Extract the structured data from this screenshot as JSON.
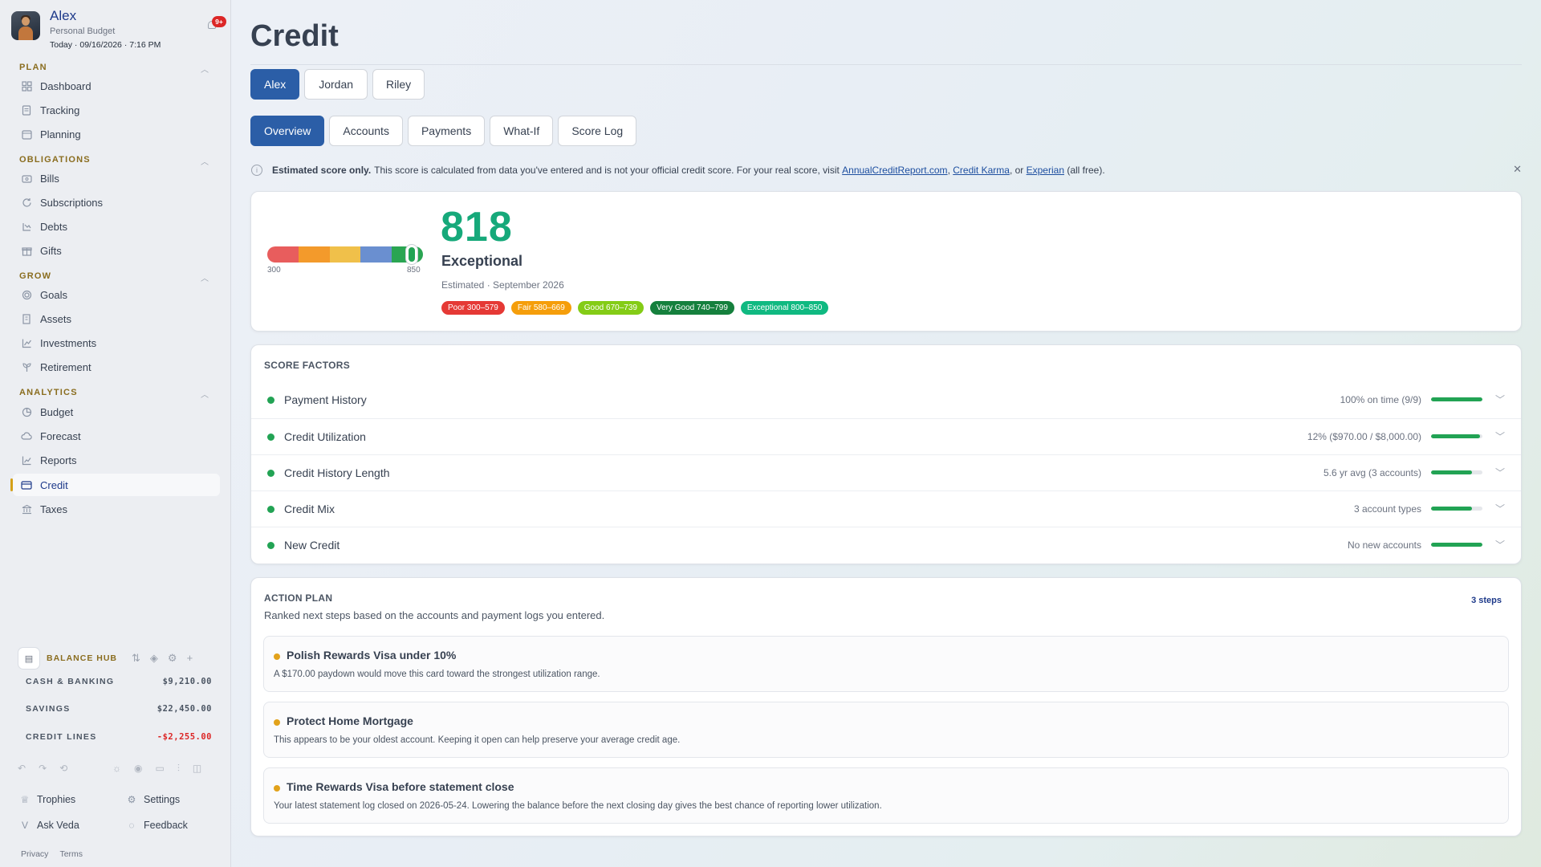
{
  "profile": {
    "name": "Alex",
    "subtitle": "Personal Budget",
    "date": "Today · 09/16/2026 · 7:16 PM",
    "notifications": "9+"
  },
  "sidebar": {
    "sections": [
      {
        "title": "PLAN",
        "items": [
          {
            "label": "Dashboard",
            "icon": "grid-icon"
          },
          {
            "label": "Tracking",
            "icon": "receipt-icon"
          },
          {
            "label": "Planning",
            "icon": "calendar-icon"
          }
        ]
      },
      {
        "title": "OBLIGATIONS",
        "items": [
          {
            "label": "Bills",
            "icon": "bill-icon"
          },
          {
            "label": "Subscriptions",
            "icon": "refresh-icon"
          },
          {
            "label": "Debts",
            "icon": "debt-icon"
          },
          {
            "label": "Gifts",
            "icon": "gift-icon"
          }
        ]
      },
      {
        "title": "GROW",
        "items": [
          {
            "label": "Goals",
            "icon": "target-icon"
          },
          {
            "label": "Assets",
            "icon": "building-icon"
          },
          {
            "label": "Investments",
            "icon": "trend-icon"
          },
          {
            "label": "Retirement",
            "icon": "sprout-icon"
          }
        ]
      },
      {
        "title": "ANALYTICS",
        "items": [
          {
            "label": "Budget",
            "icon": "pie-icon"
          },
          {
            "label": "Forecast",
            "icon": "cloud-icon"
          },
          {
            "label": "Reports",
            "icon": "chart-icon"
          },
          {
            "label": "Credit",
            "icon": "card-icon",
            "active": true
          },
          {
            "label": "Taxes",
            "icon": "bank-icon"
          }
        ]
      }
    ]
  },
  "balance_hub": {
    "title": "BALANCE HUB",
    "rows": [
      {
        "label": "CASH & BANKING",
        "value": "$9,210.00"
      },
      {
        "label": "SAVINGS",
        "value": "$22,450.00"
      },
      {
        "label": "CREDIT LINES",
        "value": "-$2,255.00",
        "negative": true
      }
    ]
  },
  "footer": {
    "trophies": "Trophies",
    "settings": "Settings",
    "ask": "Ask Veda",
    "feedback": "Feedback",
    "privacy": "Privacy",
    "terms": "Terms"
  },
  "main": {
    "title": "Credit",
    "people": [
      "Alex",
      "Jordan",
      "Riley"
    ],
    "tabs": [
      "Overview",
      "Accounts",
      "Payments",
      "What-If",
      "Score Log"
    ],
    "notice": {
      "bold": "Estimated score only.",
      "text": "This score is calculated from data you've entered and is not your official credit score. For your real score, visit",
      "link1": "AnnualCreditReport.com",
      "sep1": ",",
      "link2": "Credit Karma",
      "sep2": ", or",
      "link3": "Experian",
      "tail": "(all free)."
    },
    "score": {
      "value": "818",
      "rating": "Exceptional",
      "estimated": "Estimated · September 2026",
      "range_min": "300",
      "range_max": "850",
      "score_num": 818,
      "bands": [
        {
          "label": "Poor 300–579",
          "color": "#e53935"
        },
        {
          "label": "Fair 580–669",
          "color": "#f59e0b"
        },
        {
          "label": "Good 670–739",
          "color": "#84cc16"
        },
        {
          "label": "Very Good 740–799",
          "color": "#15803d"
        },
        {
          "label": "Exceptional 800–850",
          "color": "#10b981"
        }
      ],
      "gauge_colors": [
        "#e85d5d",
        "#f39a2b",
        "#f0c04a",
        "#6a8fd0",
        "#2aa552"
      ]
    },
    "factors": {
      "title": "SCORE FACTORS",
      "items": [
        {
          "label": "Payment History",
          "detail": "100% on time (9/9)",
          "level": 1.0
        },
        {
          "label": "Credit Utilization",
          "detail": "12% ($970.00 / $8,000.00)",
          "level": 0.95
        },
        {
          "label": "Credit History Length",
          "detail": "5.6 yr avg (3 accounts)",
          "level": 0.8
        },
        {
          "label": "Credit Mix",
          "detail": "3 account types",
          "level": 0.8
        },
        {
          "label": "New Credit",
          "detail": "No new accounts",
          "level": 1.0
        }
      ]
    },
    "action_plan": {
      "title": "ACTION PLAN",
      "subtitle": "Ranked next steps based on the accounts and payment logs you entered.",
      "count": "3 steps",
      "steps": [
        {
          "title": "Polish Rewards Visa under 10%",
          "desc": "A $170.00 paydown would move this card toward the strongest utilization range."
        },
        {
          "title": "Protect Home Mortgage",
          "desc": "This appears to be your oldest account. Keeping it open can help preserve your average credit age."
        },
        {
          "title": "Time Rewards Visa before statement close",
          "desc": "Your latest statement log closed on 2026-05-24. Lowering the balance before the next closing day gives the best chance of reporting lower utilization."
        }
      ]
    }
  }
}
